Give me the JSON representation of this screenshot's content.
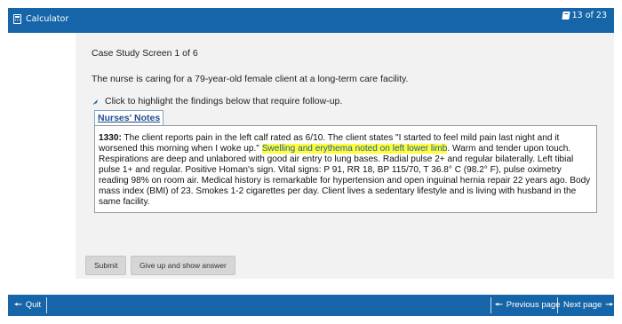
{
  "topbar": {
    "calculator_label": "Calculator",
    "counter": "13 of 23"
  },
  "main": {
    "screen_label": "Case Study Screen 1 of 6",
    "intro": "The nurse is caring for a 79-year-old female client at a long-term care facility.",
    "instruction": "Click to highlight the findings below that require follow-up.",
    "notes_tab": "Nurses' Notes",
    "note": {
      "time": "1330:",
      "text_before": " The client reports pain in the left calf rated as 6/10. The client states \"I started to feel mild pain last night and it worsened this morning when I woke up.\" ",
      "highlighted": "Swelling and erythema noted on left lower limb",
      "text_after": ". Warm and tender upon touch. Respirations are deep and unlabored with good air entry to lung bases. Radial pulse 2+ and regular bilaterally. Left tibial pulse 1+ and regular. Positive Homan's sign. Vital signs: P 91, RR 18, BP 115/70, T 36.8° C (98.2° F), pulse oximetry reading 98% on room air. Medical history is remarkable for hypertension and open inguinal hernia repair 22 years ago. Body mass index (BMI) of 23. Smokes 1-2 cigarettes per day. Client lives a sedentary lifestyle and is living with husband in the same facility."
    },
    "submit_label": "Submit",
    "giveup_label": "Give up and show answer"
  },
  "bottombar": {
    "quit_label": "Quit",
    "prev_label": "Previous page",
    "next_label": "Next page"
  },
  "colors": {
    "bar": "#1565a8",
    "content_bg": "#f2f2f2",
    "highlight": "#ffff33",
    "highlight_text": "#1a56c4"
  }
}
